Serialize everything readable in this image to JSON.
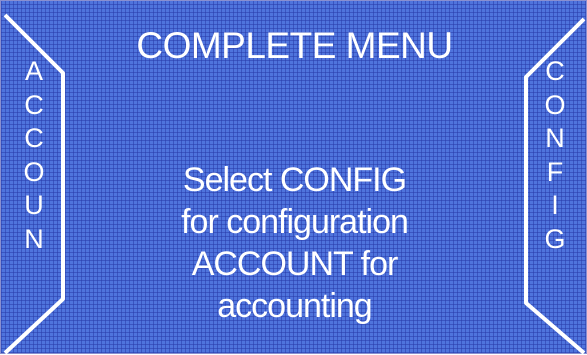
{
  "title": "COMPLETE MENU",
  "left_button": {
    "letters": [
      "A",
      "C",
      "C",
      "O",
      "U",
      "N"
    ]
  },
  "right_button": {
    "letters": [
      "C",
      "O",
      "N",
      "F",
      "I",
      "G"
    ]
  },
  "message": {
    "lines": [
      "Select CONFIG",
      "for configuration",
      "ACCOUNT for",
      "accounting"
    ]
  },
  "colors": {
    "background": "#4f74dd",
    "text": "#ffffff",
    "grid": "#283caa"
  }
}
